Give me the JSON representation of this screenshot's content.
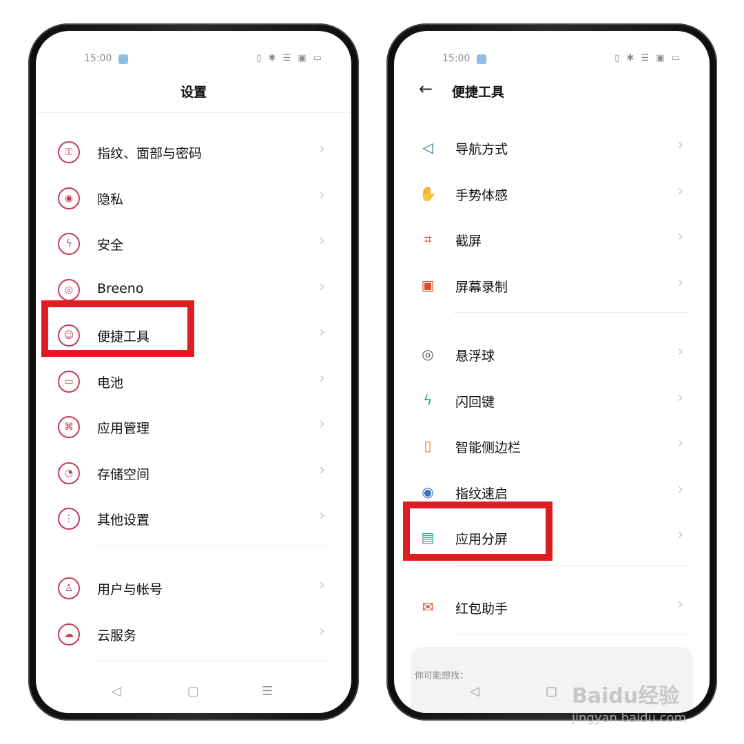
{
  "left_phone": {
    "status": {
      "time": "15:00",
      "icons": "▯ ✱ ☰ ▣ ▭"
    },
    "title": "设置",
    "items": [
      {
        "label": "指纹、面部与密码",
        "icon": "lock-icon"
      },
      {
        "label": "隐私",
        "icon": "eye-icon"
      },
      {
        "label": "安全",
        "icon": "shield-icon"
      },
      {
        "label": "Breeno",
        "icon": "target-icon"
      },
      {
        "label": "便捷工具",
        "icon": "tools-icon"
      },
      {
        "label": "电池",
        "icon": "battery-icon"
      },
      {
        "label": "应用管理",
        "icon": "apps-icon"
      },
      {
        "label": "存储空间",
        "icon": "storage-icon"
      },
      {
        "label": "其他设置",
        "icon": "more-icon"
      },
      {
        "label": "用户与帐号",
        "icon": "user-icon"
      },
      {
        "label": "云服务",
        "icon": "cloud-icon"
      }
    ],
    "nav": {
      "back": "◁",
      "home": "▢",
      "menu": "☰"
    }
  },
  "right_phone": {
    "status": {
      "time": "15:00",
      "icons": "▯ ✱ ☰ ▣ ▭"
    },
    "title": "便捷工具",
    "back": "←",
    "items": [
      {
        "label": "导航方式",
        "icon": "navigation-icon",
        "glyph": "◁",
        "color": "#3b5fa8"
      },
      {
        "label": "手势体感",
        "icon": "hand-gesture-icon",
        "glyph": "✋",
        "color": "#2e9a55"
      },
      {
        "label": "截屏",
        "icon": "crop-icon",
        "glyph": "⌗",
        "color": "#e0482a"
      },
      {
        "label": "屏幕录制",
        "icon": "screen-record-icon",
        "glyph": "▣",
        "color": "#e0482a"
      },
      {
        "label": "悬浮球",
        "icon": "floating-ball-icon",
        "glyph": "◎",
        "color": "#555555"
      },
      {
        "label": "闪回键",
        "icon": "flashback-icon",
        "glyph": "ϟ",
        "color": "#1fa58a"
      },
      {
        "label": "智能侧边栏",
        "icon": "sidebar-icon",
        "glyph": "▯",
        "color": "#e07a2a"
      },
      {
        "label": "指纹速启",
        "icon": "fingerprint-icon",
        "glyph": "◉",
        "color": "#3b70b8"
      },
      {
        "label": "应用分屏",
        "icon": "split-screen-icon",
        "glyph": "▤",
        "color": "#1fa58a"
      },
      {
        "label": "红包助手",
        "icon": "red-packet-icon",
        "glyph": "✉",
        "color": "#e0482a"
      }
    ],
    "suggest": "你可能想找：",
    "nav": {
      "back": "◁",
      "home": "▢"
    }
  },
  "watermark": {
    "brand": "Baidu经验",
    "url": "jingyan.baidu.com"
  },
  "colors": {
    "accent": "#c43a5a",
    "highlight": "#e11b22"
  }
}
